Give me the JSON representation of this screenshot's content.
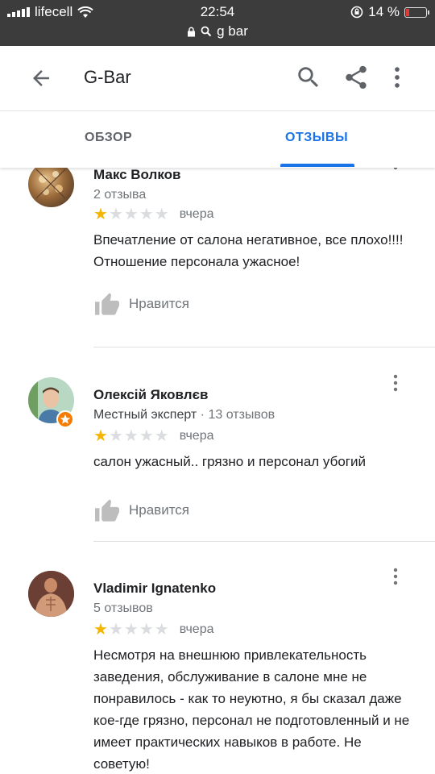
{
  "status": {
    "carrier": "lifecell",
    "time": "22:54",
    "battery": "14 %",
    "url": "g bar"
  },
  "appbar": {
    "title": "G-Bar"
  },
  "tabs": [
    {
      "label": "ОБЗОР",
      "active": false
    },
    {
      "label": "ОТЗЫВЫ",
      "active": true
    }
  ],
  "reviews": [
    {
      "name": "Макс Волков",
      "meta": "2 отзыва",
      "rating": 1,
      "when": "вчера",
      "text": "Впечатление от  салона негативное, все плохо!!!! Отношение персонала ужасное!",
      "like_label": "Нравится"
    },
    {
      "name": "Олексій Яковлєв",
      "meta_sub": "Местный эксперт",
      "meta": " · 13 отзывов",
      "rating": 1,
      "when": "вчера",
      "text": "салон ужасный.. грязно и персонал убогий",
      "like_label": "Нравится"
    },
    {
      "name": "Vladimir Ignatenko",
      "meta": "5 отзывов",
      "rating": 1,
      "when": "вчера",
      "text": "Несмотря на внешнюю привлекательность заведения, обслуживание в салоне мне не понравилось - как то неуютно, я бы сказал даже кое-где грязно, персонал не подготовленный и не имеет практических навыков в работе. Не советую!"
    }
  ],
  "colors": {
    "accent": "#1a73e8",
    "star": "#f4b400",
    "status_bar": "#3c3c3c"
  }
}
